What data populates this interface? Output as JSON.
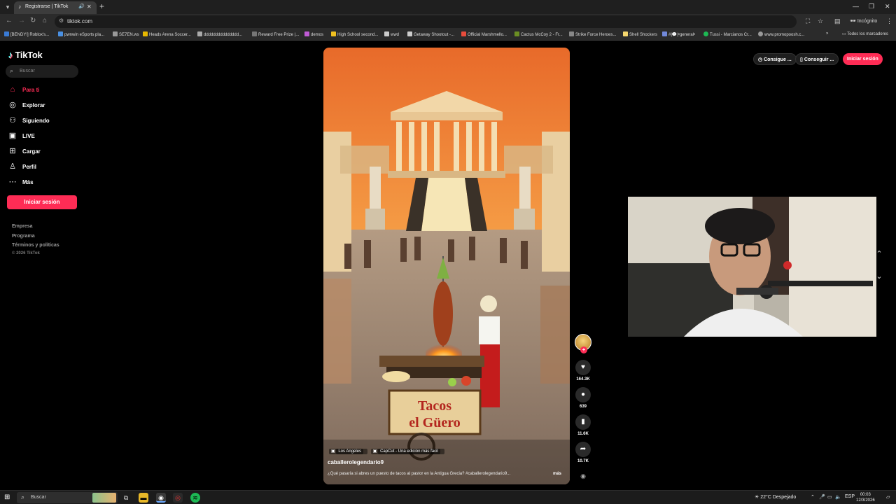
{
  "browser": {
    "tab_title": "Registrarse | TikTok",
    "url": "tiktok.com",
    "incognito_label": "Incógnito",
    "bookmarks": [
      "[BENDY!] Roblox's...",
      "pwnwin eSports pla...",
      "SE7EN.ws",
      "Heads Arena Soccer...",
      "ddddddddddddddd...",
      "Reward Free Prize |...",
      "demos",
      "High School second...",
      "wwd",
      "Getaway Shootout -...",
      "Official Marshmello...",
      "Cactus McCoy 2 - Fr...",
      "Strike Force Heroes...",
      "Shell Shockers",
      "#|💬|•general•",
      "Tussi - Marcianos Cr...",
      "www.promopoosh.c..."
    ],
    "all_bookmarks": "Todos los marcadores"
  },
  "sidebar": {
    "logo": "TikTok",
    "search_placeholder": "Buscar",
    "items": [
      {
        "label": "Para ti",
        "icon": "home-icon"
      },
      {
        "label": "Explorar",
        "icon": "compass-icon"
      },
      {
        "label": "Siguiendo",
        "icon": "following-icon"
      },
      {
        "label": "LIVE",
        "icon": "live-icon"
      },
      {
        "label": "Cargar",
        "icon": "upload-icon"
      },
      {
        "label": "Perfil",
        "icon": "profile-icon"
      },
      {
        "label": "Más",
        "icon": "more-icon"
      }
    ],
    "login_button": "Iniciar sesión",
    "footer_links": [
      "Empresa",
      "Programa",
      "Términos y políticas"
    ],
    "copyright": "© 2026 TikTok"
  },
  "header": {
    "get_coins": "Consigue ...",
    "get_app": "Conseguir ...",
    "login": "Iniciar sesión"
  },
  "video": {
    "location_tag": "Los Angeles",
    "capcut_tag": "CapCut - Una edición más fácil",
    "author": "caballerolegendario9",
    "caption": "¿Qué pasaría si abres un puesto de tacos al pastor en la Antigua Grecia? #caballerolegendario9...",
    "more": "más",
    "sign_text": "Tacos el Güero",
    "likes": "164.3K",
    "comments": "639",
    "saves": "11.6K",
    "shares": "10.7K"
  },
  "taskbar": {
    "search_placeholder": "Buscar",
    "weather": "22°C  Despejado",
    "lang": "ESP",
    "time": "00:03",
    "date": "12/3/2026"
  },
  "colors": {
    "accent": "#fe2c55",
    "background": "#000000"
  }
}
